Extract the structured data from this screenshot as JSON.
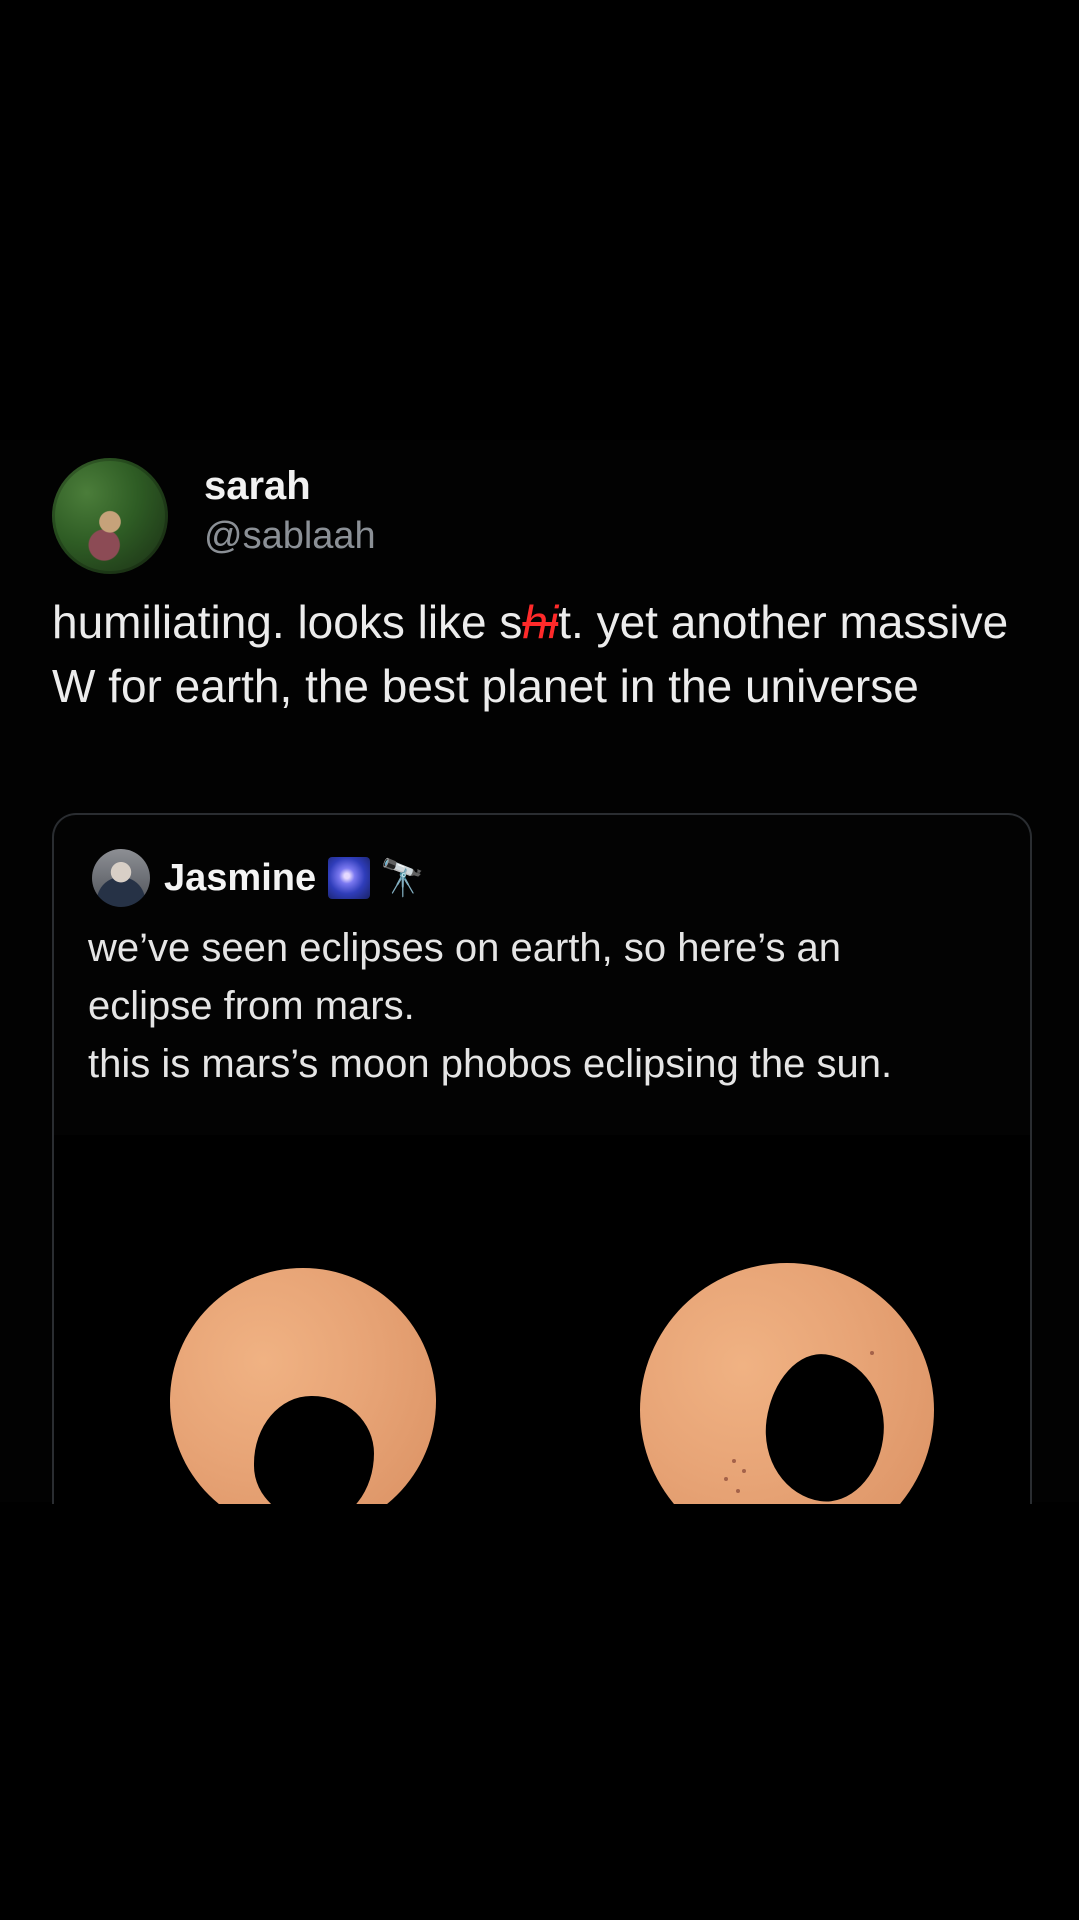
{
  "post": {
    "author": {
      "display_name": "sarah",
      "handle": "@sablaah"
    },
    "text_before": "humiliating. looks like s",
    "censored": "hi",
    "text_after": "t. yet another massive W for earth, the best planet in the universe"
  },
  "quote": {
    "author": {
      "display_name": "Jasmine",
      "emoji_icons": [
        "galaxy-icon",
        "telescope-icon"
      ]
    },
    "text_line1": "we’ve seen eclipses on earth, so here’s an",
    "text_line2": "eclipse from mars.",
    "text_line3": "this is mars’s moon phobos eclipsing the sun."
  },
  "colors": {
    "background": "#000000",
    "sun": "#e8a577",
    "censor": "#ff2a2a"
  }
}
